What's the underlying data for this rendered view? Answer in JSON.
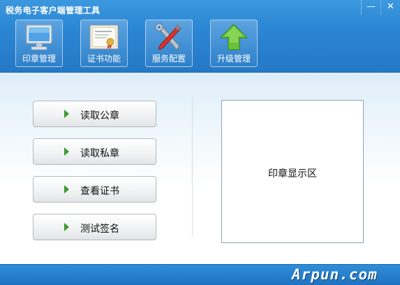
{
  "window": {
    "title": "税务电子客户端管理工具",
    "minimize_glyph": "—",
    "close_glyph": "✕"
  },
  "toolbar": {
    "items": [
      {
        "label": "印章管理",
        "icon": "monitor-icon"
      },
      {
        "label": "证书功能",
        "icon": "certificate-icon"
      },
      {
        "label": "服务配置",
        "icon": "tools-icon"
      },
      {
        "label": "升级管理",
        "icon": "up-arrow-icon"
      }
    ]
  },
  "actions": [
    {
      "label": "读取公章",
      "icon": "play-arrow-icon"
    },
    {
      "label": "读取私章",
      "icon": "play-arrow-icon"
    },
    {
      "label": "查看证书",
      "icon": "play-arrow-icon"
    },
    {
      "label": "测试签名",
      "icon": "play-arrow-icon"
    }
  ],
  "seal_display": {
    "label": "印章显示区"
  },
  "footer": {
    "watermark": "Arpun.com"
  },
  "colors": {
    "title_bar": "#2b86d4",
    "arrow_green": "#3a9a2e",
    "content_bg": "#eaf4fb"
  }
}
